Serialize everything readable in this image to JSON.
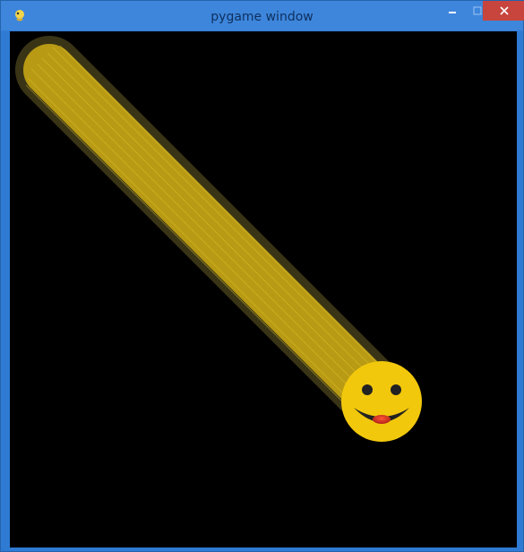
{
  "window": {
    "title": "pygame window",
    "icon": "pygame-snake-icon",
    "controls": {
      "minimize": "minimize-icon",
      "maximize": "maximize-icon",
      "close": "close-icon"
    }
  },
  "scene": {
    "background_color": "#000000",
    "trail_color": "#b89a14",
    "trail_edge_color": "#3a3416",
    "smiley_face_color": "#f2c80c",
    "smiley_feature_color": "#222222",
    "smiley_tongue_color": "#d43b1f"
  },
  "colors": {
    "titlebar": "#3d86dc",
    "close_button": "#c7453d"
  }
}
